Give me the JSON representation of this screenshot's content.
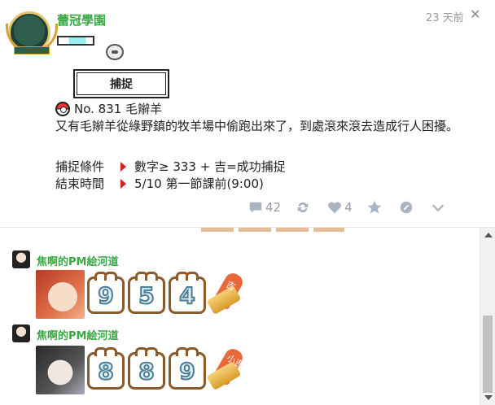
{
  "post": {
    "username": "蕾冠學園",
    "time": "23 天前",
    "catch_label": "捕捉",
    "pokedex": "No. 831 毛辮羊",
    "description": "又有毛辮羊從綠野鎮的牧羊場中偷跑出來了，到處滾來滾去造成行人困擾。",
    "condition_label": "捕捉條件",
    "condition_value": "數字≥ 333 + 吉=成功捕捉",
    "end_label": "結束時間",
    "end_value": "5/10 第一節課前(9:00)",
    "comments_count": "42",
    "likes_count": "4"
  },
  "comments": [
    {
      "name": "焦啊的PM絵河道",
      "digits": [
        "9",
        "5",
        "4"
      ],
      "lot": "吉"
    },
    {
      "name": "焦啊的PM絵河道",
      "digits": [
        "8",
        "8",
        "9"
      ],
      "lot": "小吉"
    }
  ]
}
